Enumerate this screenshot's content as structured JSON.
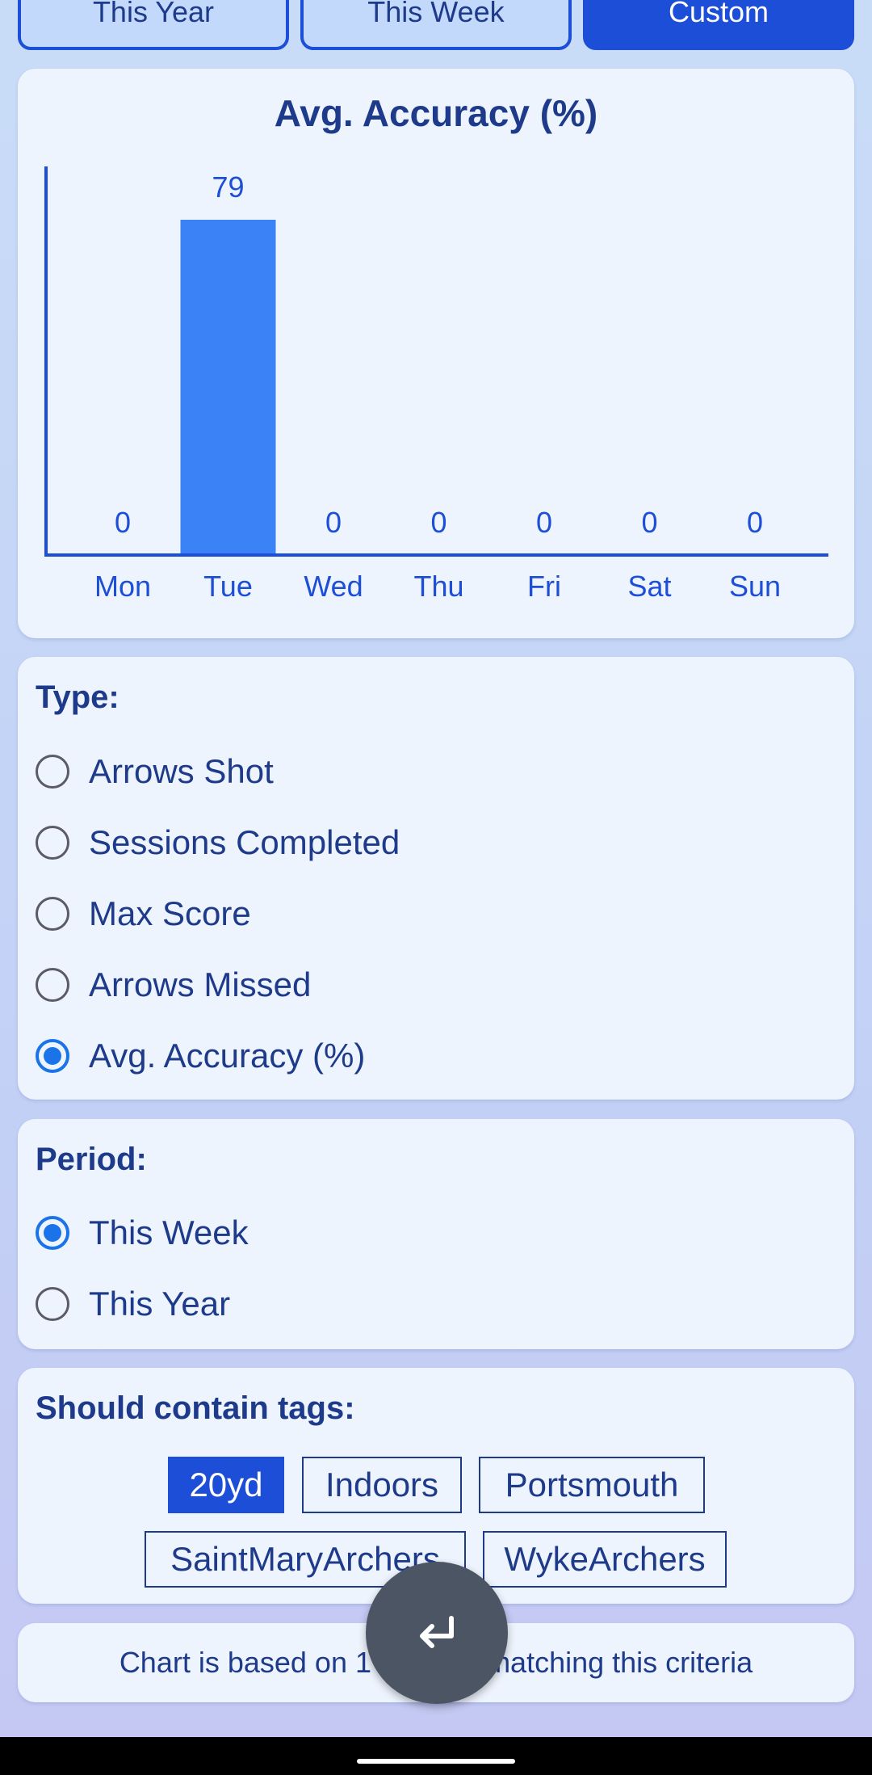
{
  "filters": [
    {
      "label": "This Year",
      "active": false
    },
    {
      "label": "This Week",
      "active": false
    },
    {
      "label": "Custom",
      "active": true
    }
  ],
  "chart_data": {
    "type": "bar",
    "title": "Avg. Accuracy (%)",
    "categories": [
      "Mon",
      "Tue",
      "Wed",
      "Thu",
      "Fri",
      "Sat",
      "Sun"
    ],
    "values": [
      0,
      79,
      0,
      0,
      0,
      0,
      0
    ],
    "ylim": [
      0,
      79
    ],
    "xlabel": "",
    "ylabel": "",
    "grid": false,
    "bar_color": "#3b82f6"
  },
  "type_section": {
    "title": "Type:",
    "options": [
      {
        "label": "Arrows Shot",
        "checked": false
      },
      {
        "label": "Sessions Completed",
        "checked": false
      },
      {
        "label": "Max Score",
        "checked": false
      },
      {
        "label": "Arrows Missed",
        "checked": false
      },
      {
        "label": "Avg. Accuracy (%)",
        "checked": true
      }
    ]
  },
  "period_section": {
    "title": "Period:",
    "options": [
      {
        "label": "This Week",
        "checked": true
      },
      {
        "label": "This Year",
        "checked": false
      }
    ]
  },
  "tags_section": {
    "title": "Should contain tags:",
    "tags": [
      {
        "label": "20yd",
        "selected": true
      },
      {
        "label": "Indoors",
        "selected": false
      },
      {
        "label": "Portsmouth",
        "selected": false
      },
      {
        "label": "SaintMaryArchers",
        "selected": false
      },
      {
        "label": "WykeArchers",
        "selected": false
      }
    ]
  },
  "footer": {
    "text": "Chart is based on 1 session matching this criteria"
  },
  "fab": {
    "icon": "return-arrow-icon"
  },
  "colors": {
    "accent": "#1d4ed8",
    "bar": "#3b82f6",
    "radio": "#1a73e8"
  }
}
